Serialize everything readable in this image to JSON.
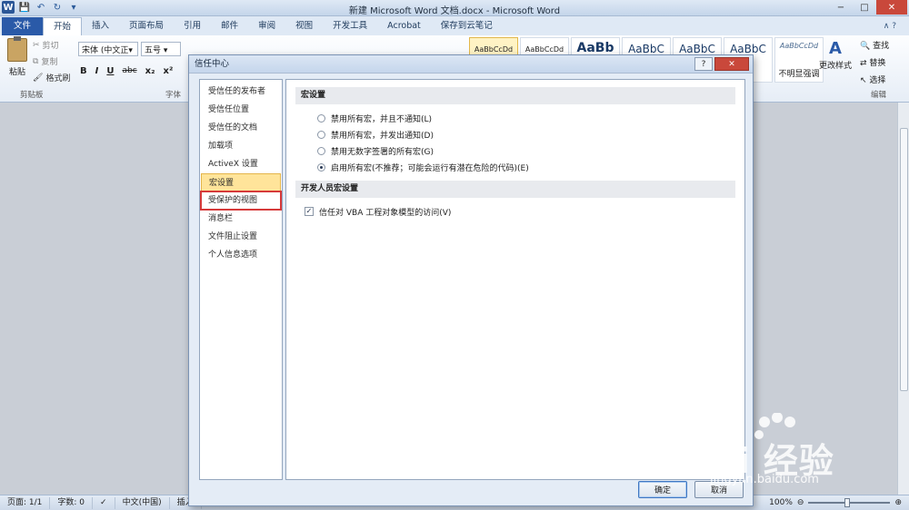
{
  "window": {
    "title": "新建 Microsoft Word 文档.docx - Microsoft Word",
    "minimize": "−",
    "maximize": "□",
    "close": "✕"
  },
  "qat": {
    "word_icon": "W",
    "save": "💾",
    "undo": "↶",
    "redo": "↻",
    "customize": "▾"
  },
  "tabs": [
    {
      "label": "文件"
    },
    {
      "label": "开始"
    },
    {
      "label": "插入"
    },
    {
      "label": "页面布局"
    },
    {
      "label": "引用"
    },
    {
      "label": "邮件"
    },
    {
      "label": "审阅"
    },
    {
      "label": "视图"
    },
    {
      "label": "开发工具"
    },
    {
      "label": "Acrobat"
    },
    {
      "label": "保存到云笔记"
    }
  ],
  "tabs_help": "∧ ?",
  "ribbon": {
    "paste_label": "粘贴",
    "cut_label": "剪切",
    "copy_label": "复制",
    "format_painter_label": "格式刷",
    "clipboard_group": "剪贴板",
    "font_name": "宋体 (中文正▾",
    "font_size": "五号 ▾",
    "font_group": "字体",
    "bold": "B",
    "italic": "I",
    "underline": "U",
    "strike": "abc",
    "subscript": "x₂",
    "superscript": "x²",
    "styles": [
      {
        "text": "AaBbCcDd"
      },
      {
        "text": "AaBbCcDd"
      },
      {
        "text": "AaBb"
      },
      {
        "text": "AaBbC"
      },
      {
        "text": "AaBbC"
      },
      {
        "text": "AaBbC"
      }
    ],
    "subtle_emphasis_preview": "AaBbCcDd",
    "subtle_emphasis_label": "不明显强调",
    "change_styles_label": "更改样式",
    "find_label": "查找",
    "replace_label": "替换",
    "select_label": "选择",
    "editing_group": "编辑"
  },
  "statusbar": {
    "page": "页面: 1/1",
    "words": "字数: 0",
    "language": "中文(中国)",
    "mode": "插入",
    "zoom": "100%",
    "zoom_level_percent": 100
  },
  "dialog": {
    "title": "信任中心",
    "help_button": "?",
    "close_button": "✕",
    "nav": [
      {
        "label": "受信任的发布者"
      },
      {
        "label": "受信任位置"
      },
      {
        "label": "受信任的文档"
      },
      {
        "label": "加载项"
      },
      {
        "label": "ActiveX 设置"
      },
      {
        "label": "宏设置"
      },
      {
        "label": "受保护的视图"
      },
      {
        "label": "消息栏"
      },
      {
        "label": "文件阻止设置"
      },
      {
        "label": "个人信息选项"
      }
    ],
    "macro_section": {
      "heading": "宏设置",
      "options": [
        {
          "label": "禁用所有宏，并且不通知(L)",
          "selected": false
        },
        {
          "label": "禁用所有宏，并发出通知(D)",
          "selected": false
        },
        {
          "label": "禁用无数字签署的所有宏(G)",
          "selected": false
        },
        {
          "label": "启用所有宏(不推荐；可能会运行有潜在危险的代码)(E)",
          "selected": true
        }
      ]
    },
    "developer_section": {
      "heading": "开发人员宏设置",
      "vba_trust_label": "信任对 VBA 工程对象模型的访问(V)",
      "vba_trust_checked": true
    },
    "ok_button": "确定",
    "cancel_button": "取消"
  },
  "watermark": {
    "brand": "Bai 经验",
    "url": "jingyan.baidu.com"
  }
}
